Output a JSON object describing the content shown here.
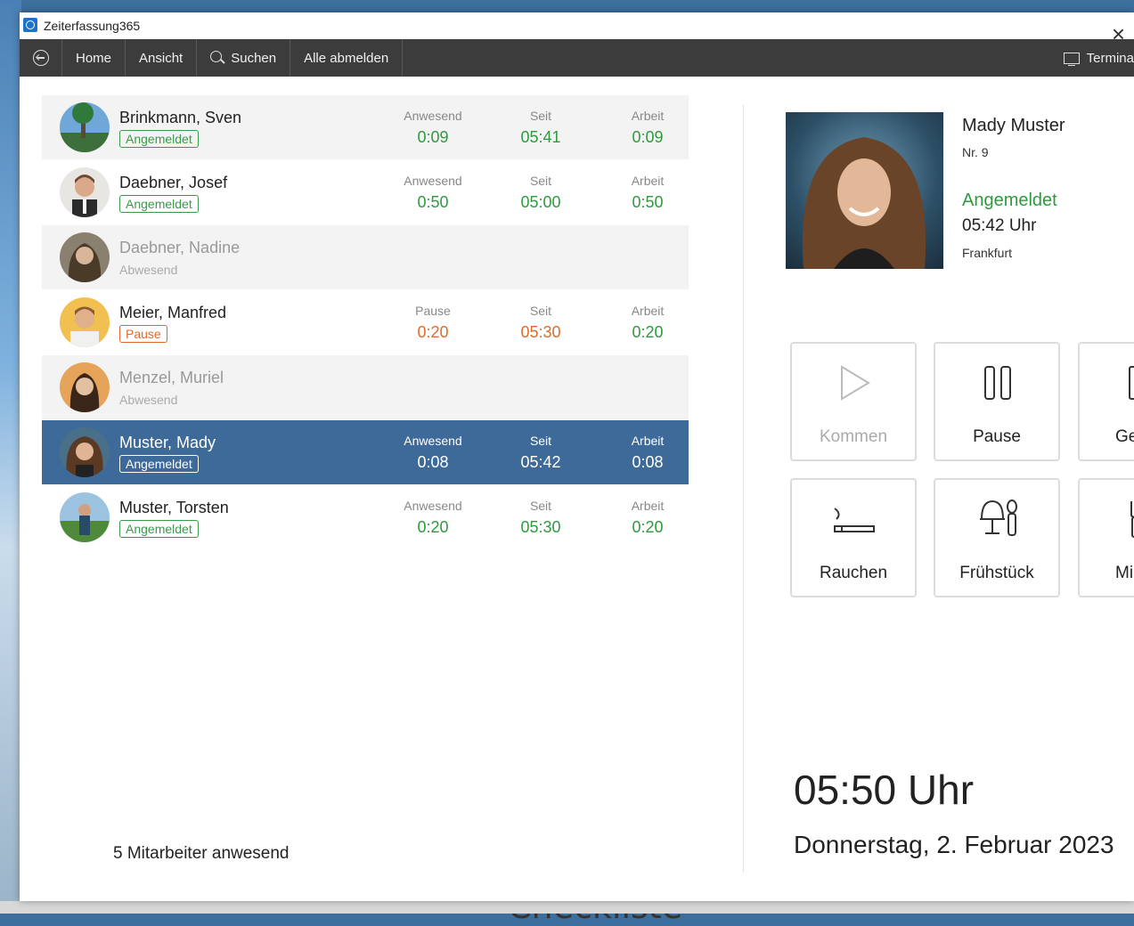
{
  "window": {
    "title": "Zeiterfassung365"
  },
  "menu": {
    "home": "Home",
    "view": "Ansicht",
    "search": "Suchen",
    "logout_all": "Alle abmelden",
    "terminal": "Termina"
  },
  "employees": [
    {
      "name": "Brinkmann, Sven",
      "status": "Angemeldet",
      "c1_label": "Anwesend",
      "c1": "0:09",
      "c2_label": "Seit",
      "c2": "05:41",
      "c3_label": "Arbeit",
      "c3": "0:09"
    },
    {
      "name": "Daebner, Josef",
      "status": "Angemeldet",
      "c1_label": "Anwesend",
      "c1": "0:50",
      "c2_label": "Seit",
      "c2": "05:00",
      "c3_label": "Arbeit",
      "c3": "0:50"
    },
    {
      "name": "Daebner, Nadine",
      "status": "Abwesend"
    },
    {
      "name": "Meier, Manfred",
      "status": "Pause",
      "c1_label": "Pause",
      "c1": "0:20",
      "c2_label": "Seit",
      "c2": "05:30",
      "c3_label": "Arbeit",
      "c3": "0:20"
    },
    {
      "name": "Menzel, Muriel",
      "status": "Abwesend"
    },
    {
      "name": "Muster, Mady",
      "status": "Angemeldet",
      "c1_label": "Anwesend",
      "c1": "0:08",
      "c2_label": "Seit",
      "c2": "05:42",
      "c3_label": "Arbeit",
      "c3": "0:08"
    },
    {
      "name": "Muster, Torsten",
      "status": "Angemeldet",
      "c1_label": "Anwesend",
      "c1": "0:20",
      "c2_label": "Seit",
      "c2": "05:30",
      "c3_label": "Arbeit",
      "c3": "0:20"
    }
  ],
  "footer": {
    "present_count": "5 Mitarbeiter anwesend"
  },
  "profile": {
    "name": "Mady Muster",
    "number": "Nr. 9",
    "status": "Angemeldet",
    "time": "05:42 Uhr",
    "location": "Frankfurt"
  },
  "actions": {
    "come": "Kommen",
    "pause": "Pause",
    "go": "Ge",
    "smoke": "Rauchen",
    "breakfast": "Frühstück",
    "lunch": "Mi"
  },
  "clock": {
    "time": "05:50 Uhr",
    "date": "Donnerstag, 2. Februar 2023"
  },
  "background": {
    "text": "Checkliste"
  },
  "colors": {
    "selected_row": "#3e6a9a",
    "present_green": "#2e9a3e",
    "pause_orange": "#e06a2a",
    "menubar": "#3c3c3c"
  }
}
